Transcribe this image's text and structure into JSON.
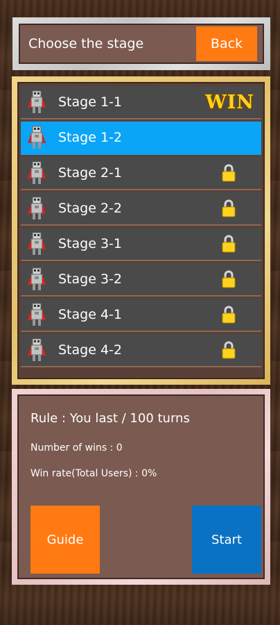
{
  "header": {
    "title": "Choose the stage",
    "back_label": "Back"
  },
  "stages": [
    {
      "label": "Stage 1-1",
      "status": "win",
      "badge": "WIN"
    },
    {
      "label": "Stage 1-2",
      "status": "selected"
    },
    {
      "label": "Stage 2-1",
      "status": "locked"
    },
    {
      "label": "Stage 2-2",
      "status": "locked"
    },
    {
      "label": "Stage 3-1",
      "status": "locked"
    },
    {
      "label": "Stage 3-2",
      "status": "locked"
    },
    {
      "label": "Stage 4-1",
      "status": "locked"
    },
    {
      "label": "Stage 4-2",
      "status": "locked"
    }
  ],
  "info": {
    "rule": "Rule : You last / 100 turns",
    "wins": "Number of wins : 0",
    "win_rate": "Win rate(Total Users) : 0%",
    "guide_label": "Guide",
    "start_label": "Start"
  },
  "colors": {
    "selected_row": "#0aa5f7",
    "orange_button": "#ff7a12",
    "start_button": "#0a72c4",
    "win_badge": "#ffd21f"
  },
  "icons": {
    "stage_icon": "robot-icon",
    "lock_icon": "lock-icon"
  }
}
